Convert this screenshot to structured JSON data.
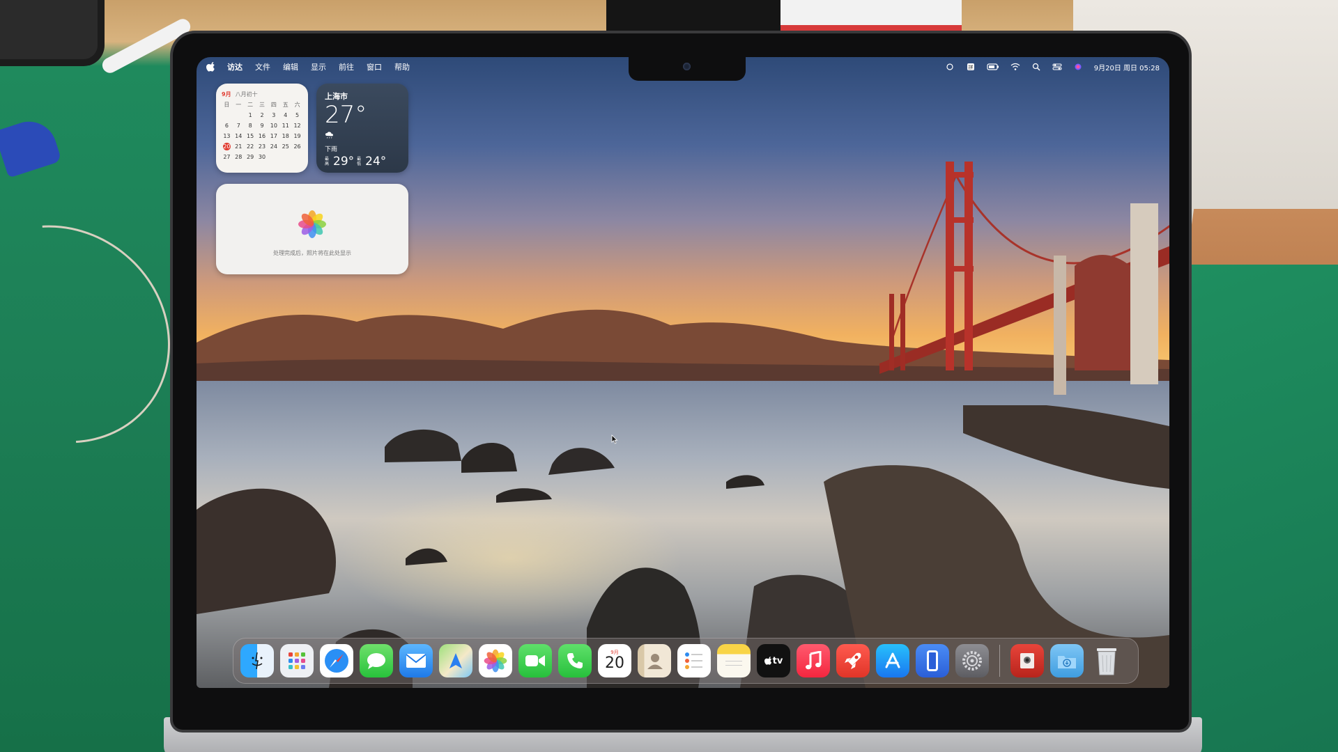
{
  "menubar": {
    "app_name": "访达",
    "items": [
      "文件",
      "编辑",
      "显示",
      "前往",
      "窗口",
      "帮助"
    ],
    "clock": "9月20日 周日 05:28"
  },
  "widgets": {
    "calendar": {
      "month": "9月",
      "lunar": "八月初十",
      "weekdays": [
        "日",
        "一",
        "二",
        "三",
        "四",
        "五",
        "六"
      ],
      "days": [
        "",
        "",
        "1",
        "2",
        "3",
        "4",
        "5",
        "6",
        "7",
        "8",
        "9",
        "10",
        "11",
        "12",
        "13",
        "14",
        "15",
        "16",
        "17",
        "18",
        "19",
        "20",
        "21",
        "22",
        "23",
        "24",
        "25",
        "26",
        "27",
        "28",
        "29",
        "30",
        "",
        "",
        ""
      ],
      "today": "20"
    },
    "weather": {
      "city": "上海市",
      "temp": "27°",
      "condition": "下雨",
      "high_label": "最高",
      "high": "29°",
      "low_label": "最低",
      "low": "24°"
    },
    "photos": {
      "message": "处理完成后，照片将在此处显示"
    }
  },
  "dock": {
    "calendar_month": "9月",
    "calendar_day": "20",
    "tv_label": "tv",
    "apps": [
      "finder-icon",
      "launchpad-icon",
      "safari-icon",
      "messages-icon",
      "mail-icon",
      "maps-icon",
      "photos-icon",
      "facetime-icon",
      "phone-icon",
      "calendar-icon",
      "contacts-icon",
      "reminders-icon",
      "notes-icon",
      "tv-icon",
      "music-icon",
      "rocket-icon",
      "app-store-icon",
      "simulator-icon",
      "system-settings-icon",
      "photo-booth-icon",
      "downloads-folder-icon",
      "trash-icon"
    ]
  },
  "colors": {
    "accent_red": "#e03c31",
    "bridge_red": "#b8322a",
    "table_green": "#1f8a5d"
  }
}
